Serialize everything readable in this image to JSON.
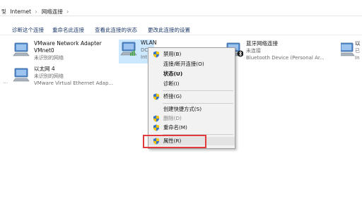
{
  "breadcrumb": {
    "items": [
      "Internet",
      "网络连接"
    ],
    "separator": "›",
    "prefix": "및"
  },
  "toolbar": {
    "buttons": [
      "诊断这个连接",
      "重命名此连接",
      "查看此连接的状态",
      "更改此连接的设置"
    ]
  },
  "connections": [
    {
      "name": "VMware Network Adapter",
      "line2": "VMnet0",
      "line3": "未识别的网络",
      "icon": "network-adapter-icon"
    },
    {
      "name": "WLAN",
      "line2": "DC",
      "line3": "Int",
      "icon": "wireless-adapter-icon"
    },
    {
      "name": "蓝牙网络连接",
      "line2": "未连接",
      "line3": "Bluetooth Device (Personal Ar...",
      "icon": "bluetooth-adapter-icon"
    },
    {
      "name": "以",
      "line2": "已",
      "line3": "In",
      "icon": "network-adapter-icon"
    },
    {
      "name": "以太网 4",
      "line2": "未识别的网络",
      "line3": "VMware Virtual Ethernet Adap...",
      "icon": "network-adapter-icon"
    }
  ],
  "context_menu": {
    "items": [
      {
        "label": "禁用(B)",
        "shield": true
      },
      {
        "label": "连接/断开连接(O)",
        "shield": false
      },
      {
        "label": "状态(U)",
        "shield": false,
        "bold": true
      },
      {
        "label": "诊断(I)",
        "shield": false
      },
      {
        "label": "桥接(G)",
        "shield": true
      },
      {
        "label": "创建快捷方式(S)",
        "shield": false
      },
      {
        "label": "删除(D)",
        "shield": true,
        "disabled": true
      },
      {
        "label": "重命名(M)",
        "shield": true
      },
      {
        "label": "属性(R)",
        "shield": true,
        "highlighted": true
      }
    ]
  },
  "colors": {
    "selection": "#cce8ff",
    "highlight_box": "#e23b3b",
    "link": "#1e3a6b"
  }
}
